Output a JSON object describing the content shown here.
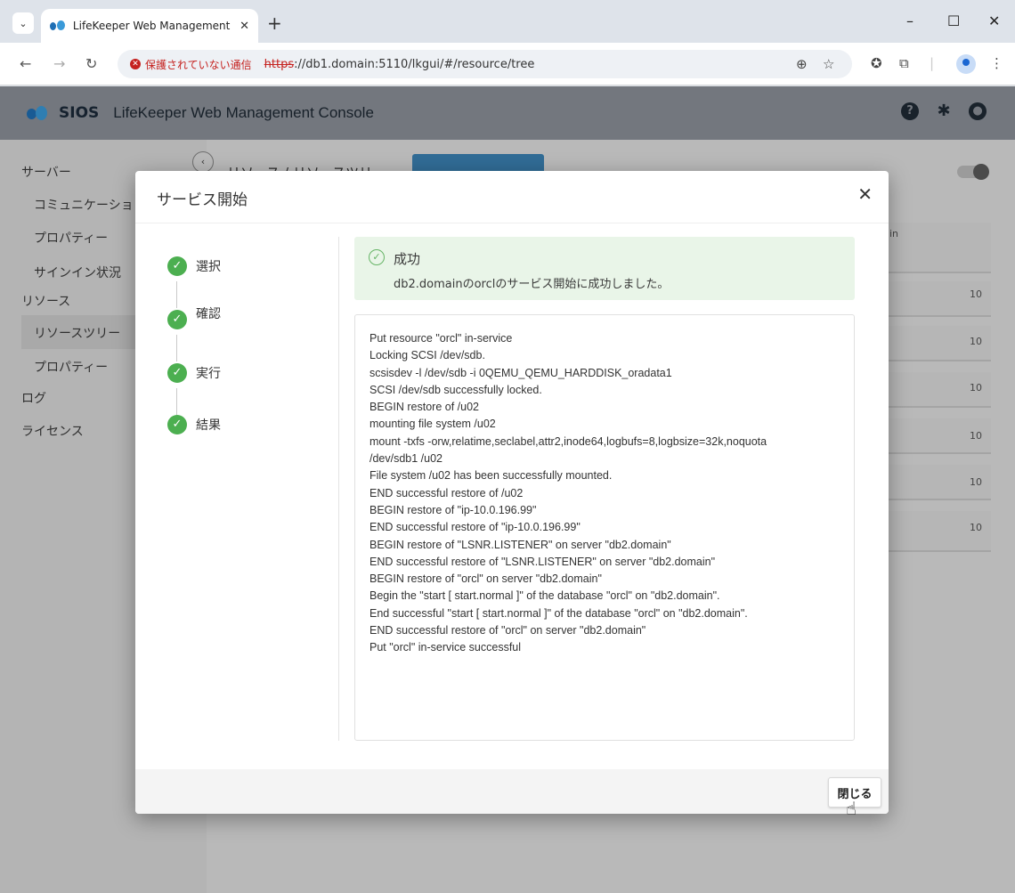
{
  "browser": {
    "tab_title": "LifeKeeper Web Management C",
    "tab_close": "✕",
    "new_tab": "+",
    "win_minimize": "–",
    "win_maximize": "☐",
    "win_close": "✕",
    "insecure_label": "保護されていない通信",
    "url_scheme": "https",
    "url_rest": "://db1.domain:5110/lkgui/#/resource/tree"
  },
  "app": {
    "logo_text": "SIOS",
    "title": "LifeKeeper Web Management Console"
  },
  "sidebar": {
    "items": [
      {
        "label": "サーバー"
      },
      {
        "label": "コミュニケーショ"
      },
      {
        "label": "プロパティー"
      },
      {
        "label": "サインイン状況"
      },
      {
        "label": "リソース"
      },
      {
        "label": "リソースツリー"
      },
      {
        "label": "プロパティー"
      },
      {
        "label": "ログ"
      },
      {
        "label": "ライセンス"
      }
    ]
  },
  "background": {
    "breadcrumb": "リソース / リソースツリー",
    "table_header": "in",
    "row_values": [
      "10",
      "10",
      "10",
      "10",
      "10",
      "10"
    ]
  },
  "modal": {
    "title": "サービス開始",
    "close": "✕",
    "steps": [
      {
        "label": "選択"
      },
      {
        "label": "確認"
      },
      {
        "label": "実行"
      },
      {
        "label": "結果"
      }
    ],
    "success_title": "成功",
    "success_message": "db2.domainのorclのサービス開始に成功しました。",
    "log_lines": [
      "Put resource \"orcl\" in-service",
      "Locking SCSI /dev/sdb.",
      "scsisdev -l /dev/sdb -i 0QEMU_QEMU_HARDDISK_oradata1",
      "SCSI /dev/sdb successfully locked.",
      "BEGIN restore of /u02",
      "mounting file system /u02",
      "mount -txfs -orw,relatime,seclabel,attr2,inode64,logbufs=8,logbsize=32k,noquota",
      "/dev/sdb1 /u02",
      "File system /u02 has been successfully mounted.",
      "END successful restore of /u02",
      "BEGIN restore of \"ip-10.0.196.99\"",
      "END successful restore of \"ip-10.0.196.99\"",
      "BEGIN restore of \"LSNR.LISTENER\" on server \"db2.domain\"",
      "END successful restore of \"LSNR.LISTENER\" on server \"db2.domain\"",
      "BEGIN restore of \"orcl\" on server \"db2.domain\"",
      "Begin the \"start [ start.normal ]\" of the database \"orcl\" on \"db2.domain\".",
      "End successful \"start [ start.normal ]\" of the database \"orcl\" on \"db2.domain\".",
      "END successful restore of \"orcl\" on server \"db2.domain\"",
      "Put \"orcl\" in-service successful"
    ],
    "close_button": "閉じる"
  },
  "colors": {
    "success": "#4caf50",
    "success_bg": "#e9f5e8",
    "insecure": "#c5221f",
    "header_bg": "#8d929a"
  }
}
